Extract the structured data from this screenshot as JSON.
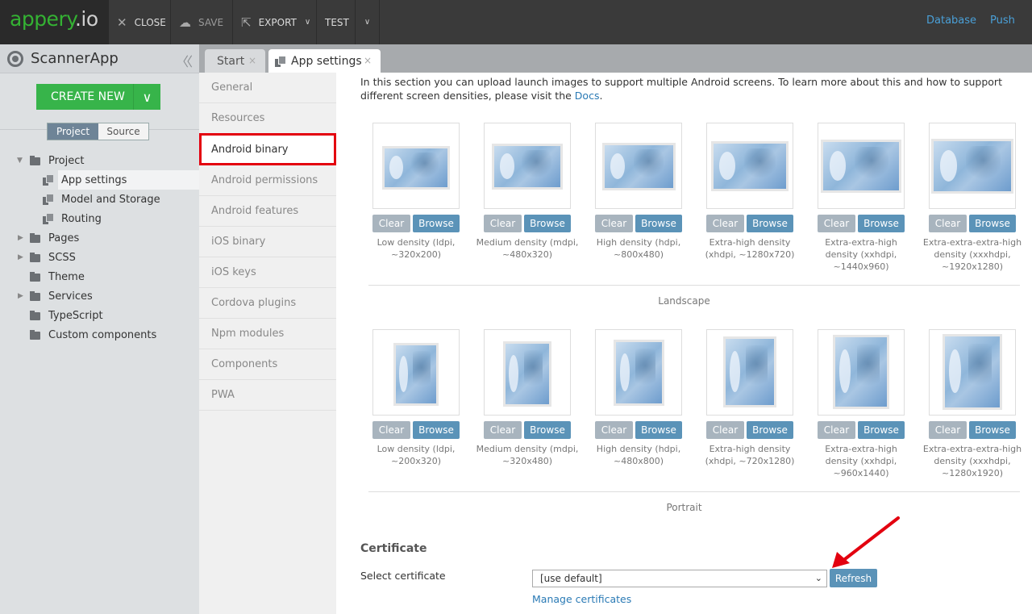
{
  "topbar": {
    "logo_main": "appery",
    "logo_suffix": ".io",
    "close_label": "CLOSE",
    "save_label": "SAVE",
    "export_label": "EXPORT",
    "test_label": "TEST",
    "database_link": "Database",
    "push_link": "Push"
  },
  "sidebar": {
    "app_name": "ScannerApp",
    "create_new_label": "CREATE NEW",
    "toggle": {
      "project": "Project",
      "source": "Source"
    },
    "tree": [
      {
        "label": "Project",
        "kind": "folder",
        "expanded": true
      },
      {
        "label": "App settings",
        "kind": "file",
        "selected": true
      },
      {
        "label": "Model and Storage",
        "kind": "file"
      },
      {
        "label": "Routing",
        "kind": "file"
      },
      {
        "label": "Pages",
        "kind": "folder",
        "expanded": false
      },
      {
        "label": "SCSS",
        "kind": "folder",
        "expanded": false
      },
      {
        "label": "Theme",
        "kind": "folder"
      },
      {
        "label": "Services",
        "kind": "folder",
        "expanded": false
      },
      {
        "label": "TypeScript",
        "kind": "folder"
      },
      {
        "label": "Custom components",
        "kind": "folder"
      }
    ]
  },
  "tabs": {
    "start": "Start",
    "app_settings": "App settings",
    "close_glyph": "×"
  },
  "settings_nav": [
    {
      "label": "General"
    },
    {
      "label": "Resources"
    },
    {
      "label": "Android binary",
      "active": true
    },
    {
      "label": "Android permissions"
    },
    {
      "label": "Android features"
    },
    {
      "label": "iOS binary"
    },
    {
      "label": "iOS keys"
    },
    {
      "label": "Cordova plugins"
    },
    {
      "label": "Npm modules"
    },
    {
      "label": "Components"
    },
    {
      "label": "PWA"
    }
  ],
  "content": {
    "intro_text": "In this section you can upload launch images to support multiple Android screens. To learn more about this and how to support different screen densities, please visit the ",
    "intro_link": "Docs",
    "intro_end": ".",
    "clear_label": "Clear",
    "browse_label": "Browse",
    "landscape": {
      "label": "Landscape",
      "cards": [
        {
          "caption": "Low density (ldpi, ~320x200)"
        },
        {
          "caption": "Medium density (mdpi, ~480x320)"
        },
        {
          "caption": "High density (hdpi, ~800x480)"
        },
        {
          "caption": "Extra-high density (xhdpi, ~1280x720)"
        },
        {
          "caption": "Extra-extra-high density (xxhdpi, ~1440x960)"
        },
        {
          "caption": "Extra-extra-extra-high density (xxxhdpi, ~1920x1280)"
        }
      ]
    },
    "portrait": {
      "label": "Portrait",
      "cards": [
        {
          "caption": "Low density (ldpi, ~200x320)"
        },
        {
          "caption": "Medium density (mdpi, ~320x480)"
        },
        {
          "caption": "High density (hdpi, ~480x800)"
        },
        {
          "caption": "Extra-high density (xhdpi, ~720x1280)"
        },
        {
          "caption": "Extra-extra-high density (xxhdpi, ~960x1440)"
        },
        {
          "caption": "Extra-extra-extra-high density (xxxhdpi, ~1280x1920)"
        }
      ]
    },
    "certificate": {
      "heading": "Certificate",
      "select_label": "Select certificate",
      "selected_value": "[use default]",
      "refresh_label": "Refresh",
      "manage_link": "Manage certificates"
    }
  },
  "colors": {
    "brand_green": "#34b233",
    "create_button": "#37b44a",
    "link_blue": "#2a7ab5",
    "button_blue": "#5b93b8",
    "highlight_red": "#e3000f"
  }
}
